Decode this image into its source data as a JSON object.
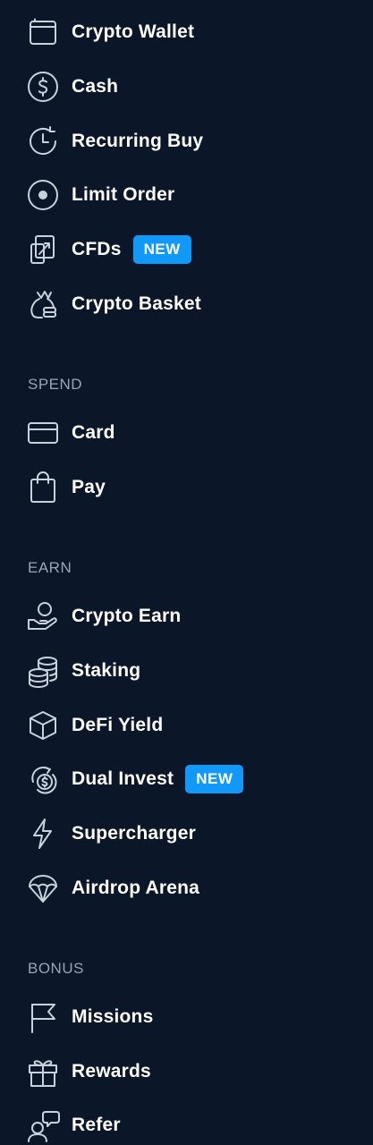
{
  "menu": {
    "trade": [
      {
        "label": "Crypto Wallet",
        "icon": "wallet-icon"
      },
      {
        "label": "Cash",
        "icon": "dollar-circle-icon"
      },
      {
        "label": "Recurring Buy",
        "icon": "recurring-clock-icon"
      },
      {
        "label": "Limit Order",
        "icon": "target-icon"
      },
      {
        "label": "CFDs",
        "icon": "cfd-arrows-icon",
        "badge": "NEW"
      },
      {
        "label": "Crypto Basket",
        "icon": "basket-bag-icon"
      }
    ],
    "spend": {
      "header": "SPEND",
      "items": [
        {
          "label": "Card",
          "icon": "card-icon"
        },
        {
          "label": "Pay",
          "icon": "shopping-bag-icon"
        }
      ]
    },
    "earn": {
      "header": "EARN",
      "items": [
        {
          "label": "Crypto Earn",
          "icon": "hand-coin-icon"
        },
        {
          "label": "Staking",
          "icon": "coin-stack-icon"
        },
        {
          "label": "DeFi Yield",
          "icon": "cube-icon"
        },
        {
          "label": "Dual Invest",
          "icon": "dual-invest-icon",
          "badge": "NEW"
        },
        {
          "label": "Supercharger",
          "icon": "lightning-icon"
        },
        {
          "label": "Airdrop Arena",
          "icon": "parachute-icon"
        }
      ]
    },
    "bonus": {
      "header": "BONUS",
      "items": [
        {
          "label": "Missions",
          "icon": "flag-icon"
        },
        {
          "label": "Rewards",
          "icon": "gift-icon"
        },
        {
          "label": "Refer",
          "icon": "refer-user-icon"
        }
      ]
    }
  },
  "colors": {
    "background": "#0b1628",
    "badge": "#1199fa",
    "icon": "#c9d1dd",
    "section_header": "#9aa4b3"
  }
}
